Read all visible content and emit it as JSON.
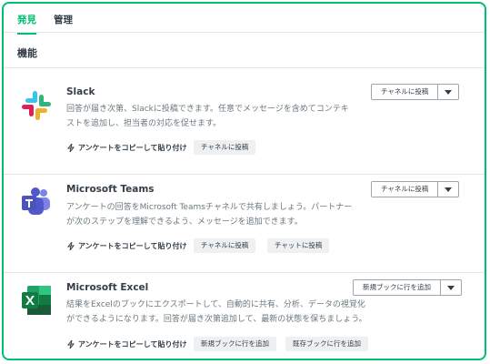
{
  "tabs": [
    {
      "label": "発見",
      "active": true
    },
    {
      "label": "管理",
      "active": false
    }
  ],
  "section": {
    "title": "機能"
  },
  "integrations": [
    {
      "icon": "slack-logo-icon",
      "title": "Slack",
      "description_line1": "回答が届き次第、Slackに投稿できます。任意でメッセージを含めてコンテキ",
      "description_line2": "ストを追加し、担当者の対応を促せます。",
      "copy_label": "アンケートをコピーして貼り付け",
      "chips": [
        "チャネルに投稿"
      ],
      "split_label": "チャネルに投稿"
    },
    {
      "icon": "microsoft-teams-logo-icon",
      "title": "Microsoft Teams",
      "description_line1": "アンケートの回答をMicrosoft Teamsチャネルで共有しましょう。パートナー",
      "description_line2": "が次のステップを理解できるよう、メッセージを追加できます。",
      "copy_label": "アンケートをコピーして貼り付け",
      "chips": [
        "チャネルに投稿",
        "チャットに投稿"
      ],
      "split_label": "チャネルに投稿"
    },
    {
      "icon": "microsoft-excel-logo-icon",
      "title": "Microsoft Excel",
      "description_line1": "結果をExcelのブックにエクスポートして、自動的に共有、分析、データの視覚化",
      "description_line2": "ができるようになります。回答が届き次第追加して、最新の状態を保ちましょう。",
      "copy_label": "アンケートをコピーして貼り付け",
      "chips": [
        "新規ブックに行を追加",
        "既存ブックに行を追加"
      ],
      "split_label": "新規ブックに行を追加"
    }
  ],
  "colors": {
    "accent": "#00bf6f",
    "text": "#333e48",
    "muted": "#6b787f",
    "chip_bg": "#eef0f1"
  }
}
